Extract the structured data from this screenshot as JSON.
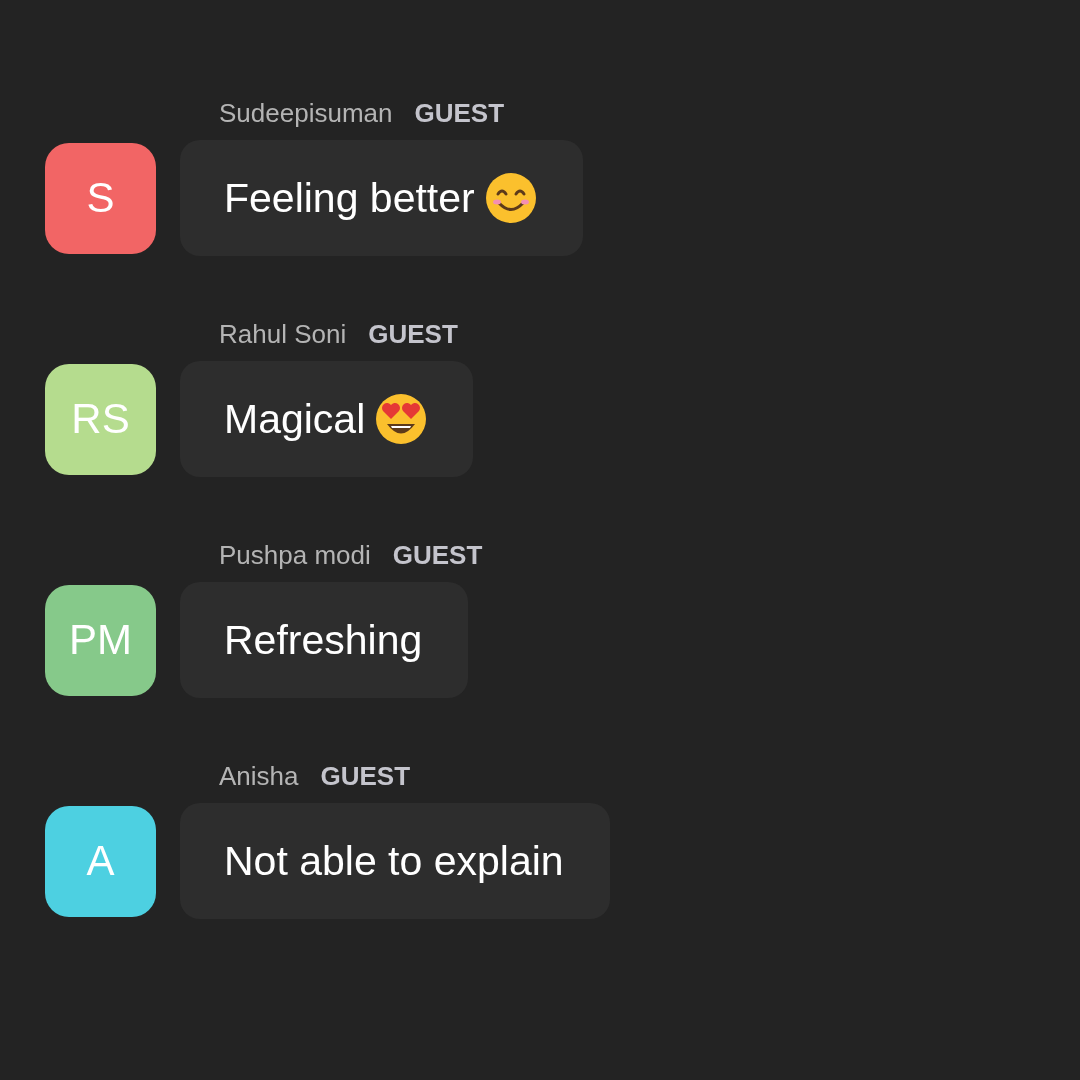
{
  "messages": [
    {
      "name": "Sudeepisuman",
      "role": "GUEST",
      "initials": "S",
      "color": "#f26565",
      "text": "Feeling better",
      "emoji": {
        "kind": "smile"
      }
    },
    {
      "name": "Rahul Soni",
      "role": "GUEST",
      "initials": "RS",
      "color": "#b5dc8e",
      "text": "Magical",
      "emoji": {
        "kind": "heart-eyes"
      }
    },
    {
      "name": "Pushpa modi",
      "role": "GUEST",
      "initials": "PM",
      "color": "#86c98a",
      "text": "Refreshing"
    },
    {
      "name": "Anisha",
      "role": "GUEST",
      "initials": "A",
      "color": "#4dd0e1",
      "text": "Not able to explain"
    }
  ]
}
